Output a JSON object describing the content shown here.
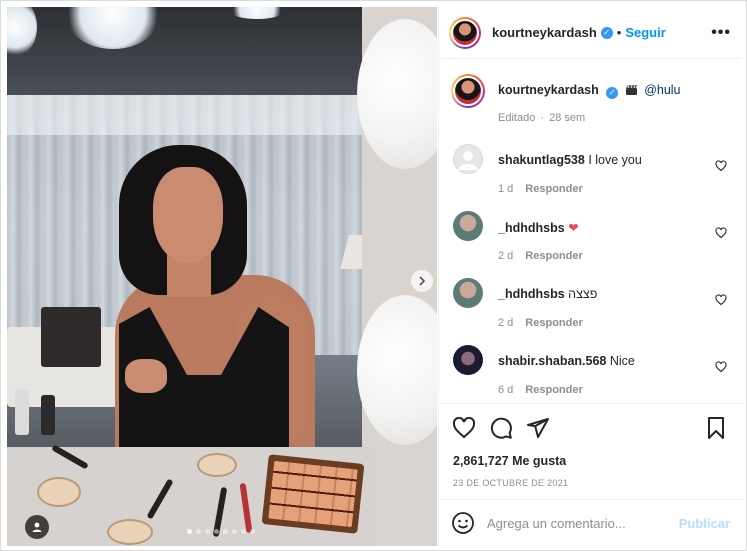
{
  "post": {
    "username": "kourtneykardash",
    "follow_label": "Seguir",
    "separator": "•",
    "more_icon": "more-horizontal-icon",
    "verified_icon": "verified-badge-icon"
  },
  "caption": {
    "username": "kourtneykardash",
    "text": "@hulu",
    "emoji_icon": "clapperboard-icon",
    "edited": "Editado",
    "age": "28 sem"
  },
  "comments": [
    {
      "username": "shakuntlag538",
      "text": "I love you",
      "age": "1 d",
      "reply": "Responder",
      "avatar": "default-avatar"
    },
    {
      "username": "_hdhdhsbs",
      "text": "❤",
      "age": "2 d",
      "reply": "Responder",
      "avatar": "photo-avatar"
    },
    {
      "username": "_hdhdhsbs",
      "text": "פצצה",
      "age": "2 d",
      "reply": "Responder",
      "avatar": "photo-avatar"
    },
    {
      "username": "shabir.shaban.568",
      "text": "Nice",
      "age": "6 d",
      "reply": "Responder",
      "avatar": "photo-avatar"
    }
  ],
  "actions": {
    "like_icon": "heart-icon",
    "comment_icon": "comment-icon",
    "share_icon": "send-icon",
    "save_icon": "bookmark-icon"
  },
  "likes": "2,861,727 Me gusta",
  "date": "23 DE OCTUBRE DE 2021",
  "add_comment": {
    "placeholder": "Agrega un comentario...",
    "post_label": "Publicar",
    "emoji_icon": "smiley-icon"
  },
  "media": {
    "next_icon": "chevron-right-icon",
    "tag_icon": "user-tag-icon",
    "carousel_count": 8,
    "carousel_active": 1
  },
  "colors": {
    "accent": "#0095f6",
    "publish_disabled": "#b2dffc",
    "secondary_text": "#8e8e8e",
    "heart_red": "#ed4956"
  }
}
